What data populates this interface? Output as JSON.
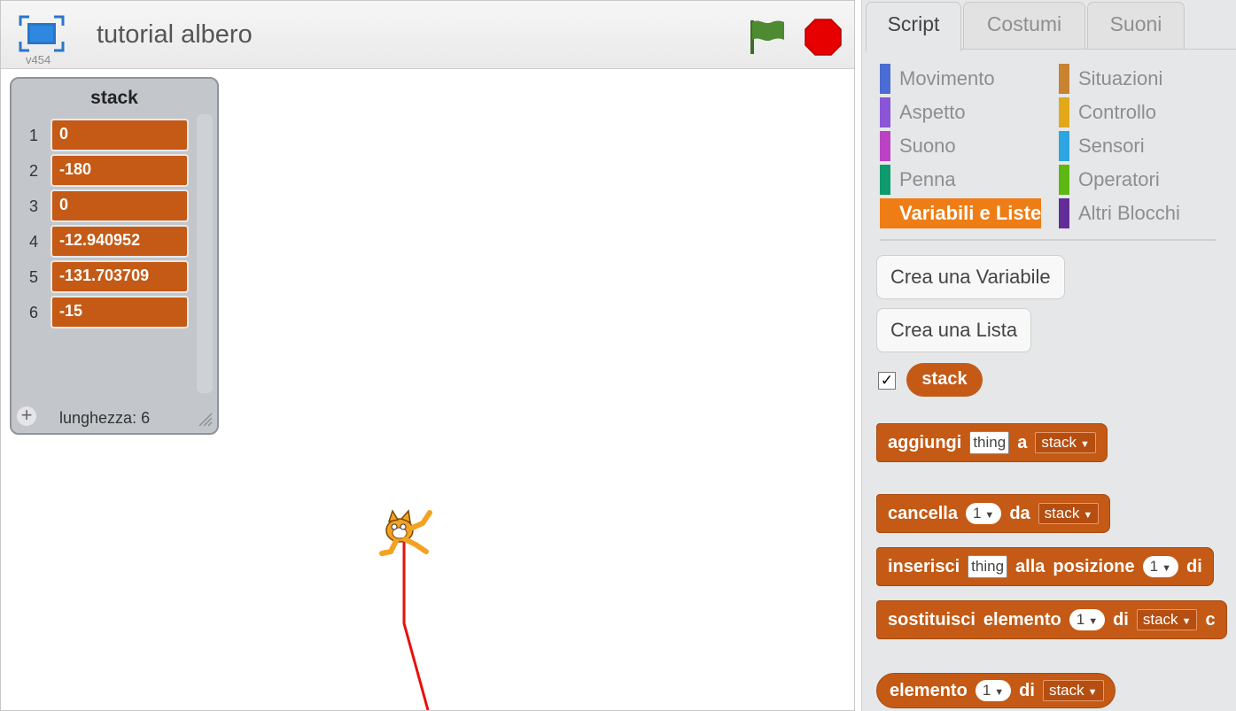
{
  "header": {
    "project_title": "tutorial albero",
    "version": "v454"
  },
  "stage": {
    "list_monitor": {
      "name": "stack",
      "items": [
        "0",
        "-180",
        "0",
        "-12.940952",
        "-131.703709",
        "-15"
      ],
      "indices": [
        "1",
        "2",
        "3",
        "4",
        "5",
        "6"
      ],
      "length_label": "lunghezza: 6",
      "add_glyph": "+"
    }
  },
  "tabs": [
    {
      "label": "Script",
      "active": true
    },
    {
      "label": "Costumi",
      "active": false
    },
    {
      "label": "Suoni",
      "active": false
    }
  ],
  "categories": {
    "left": [
      {
        "label": "Movimento",
        "color": "#4a6cd4"
      },
      {
        "label": "Aspetto",
        "color": "#8a55d7"
      },
      {
        "label": "Suono",
        "color": "#bb42c3"
      },
      {
        "label": "Penna",
        "color": "#0e9a6c"
      },
      {
        "label": "Variabili e Liste",
        "color": "#ee7d16",
        "active": true
      }
    ],
    "right": [
      {
        "label": "Situazioni",
        "color": "#c88330"
      },
      {
        "label": "Controllo",
        "color": "#e1a91a"
      },
      {
        "label": "Sensori",
        "color": "#2ca5e2"
      },
      {
        "label": "Operatori",
        "color": "#5cb712"
      },
      {
        "label": "Altri Blocchi",
        "color": "#632d99"
      }
    ]
  },
  "palette": {
    "create_variable": "Crea una Variabile",
    "create_list": "Crea una Lista",
    "stack_checkbox": "✓",
    "stack_reporter": "stack",
    "blocks": {
      "add": {
        "w1": "aggiungi",
        "slot1": "thing",
        "w2": "a",
        "drop": "stack"
      },
      "delete": {
        "w1": "cancella",
        "num": "1",
        "w2": "da",
        "drop": "stack"
      },
      "insert": {
        "w1": "inserisci",
        "slot1": "thing",
        "w2": "alla",
        "w3": "posizione",
        "num": "1",
        "w4": "di"
      },
      "replace": {
        "w1": "sostituisci",
        "w2": "elemento",
        "num": "1",
        "w3": "di",
        "drop": "stack",
        "w4": "c"
      },
      "item": {
        "w1": "elemento",
        "num": "1",
        "w2": "di",
        "drop": "stack"
      }
    }
  },
  "colors": {
    "list_block": "#c45a15",
    "pen_line": "#e8100c",
    "accent": "#ee7d16"
  }
}
